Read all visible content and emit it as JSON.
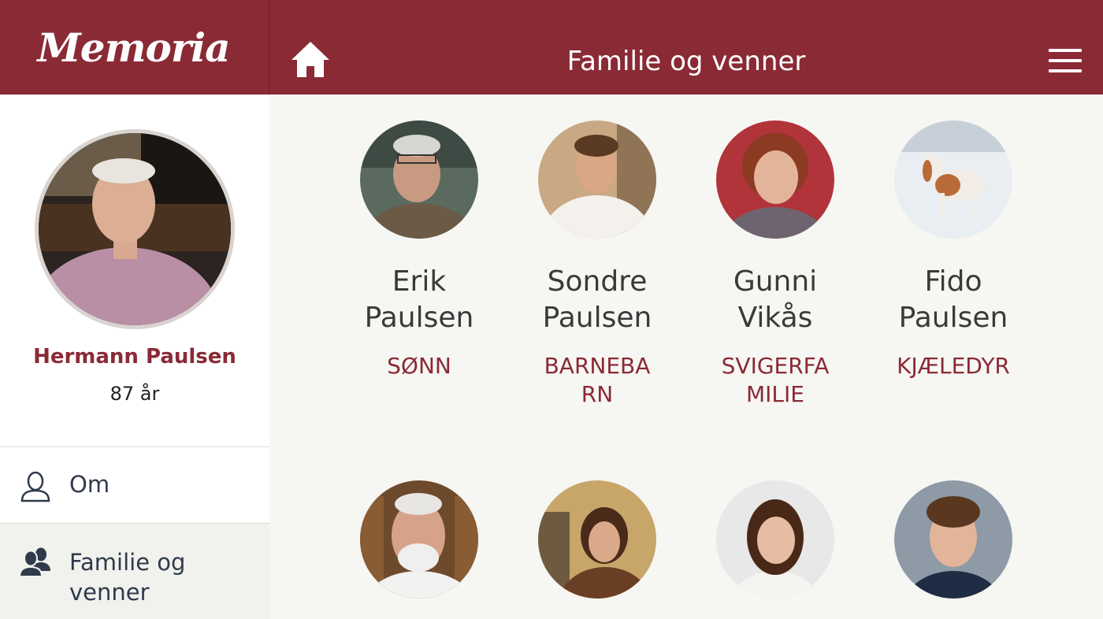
{
  "app": {
    "logo": "Memoria",
    "title": "Familie og venner"
  },
  "profile": {
    "name": "Hermann Paulsen",
    "age": "87 år"
  },
  "nav": [
    {
      "label": "Om",
      "icon": "person-icon"
    },
    {
      "label": "Familie og venner",
      "icon": "group-icon"
    }
  ],
  "people": [
    {
      "first": "Erik",
      "last": "Paulsen",
      "relation": "SØNN"
    },
    {
      "first": "Sondre",
      "last": "Paulsen",
      "relation": "BARNEBARN"
    },
    {
      "first": "Gunni",
      "last": "Vikås",
      "relation": "SVIGERFAMILIE"
    },
    {
      "first": "Fido",
      "last": "Paulsen",
      "relation": "KJÆLEDYR"
    }
  ],
  "colors": {
    "brand": "#8a2a35",
    "background": "#f6f6f3",
    "text": "#3a3a3a"
  }
}
